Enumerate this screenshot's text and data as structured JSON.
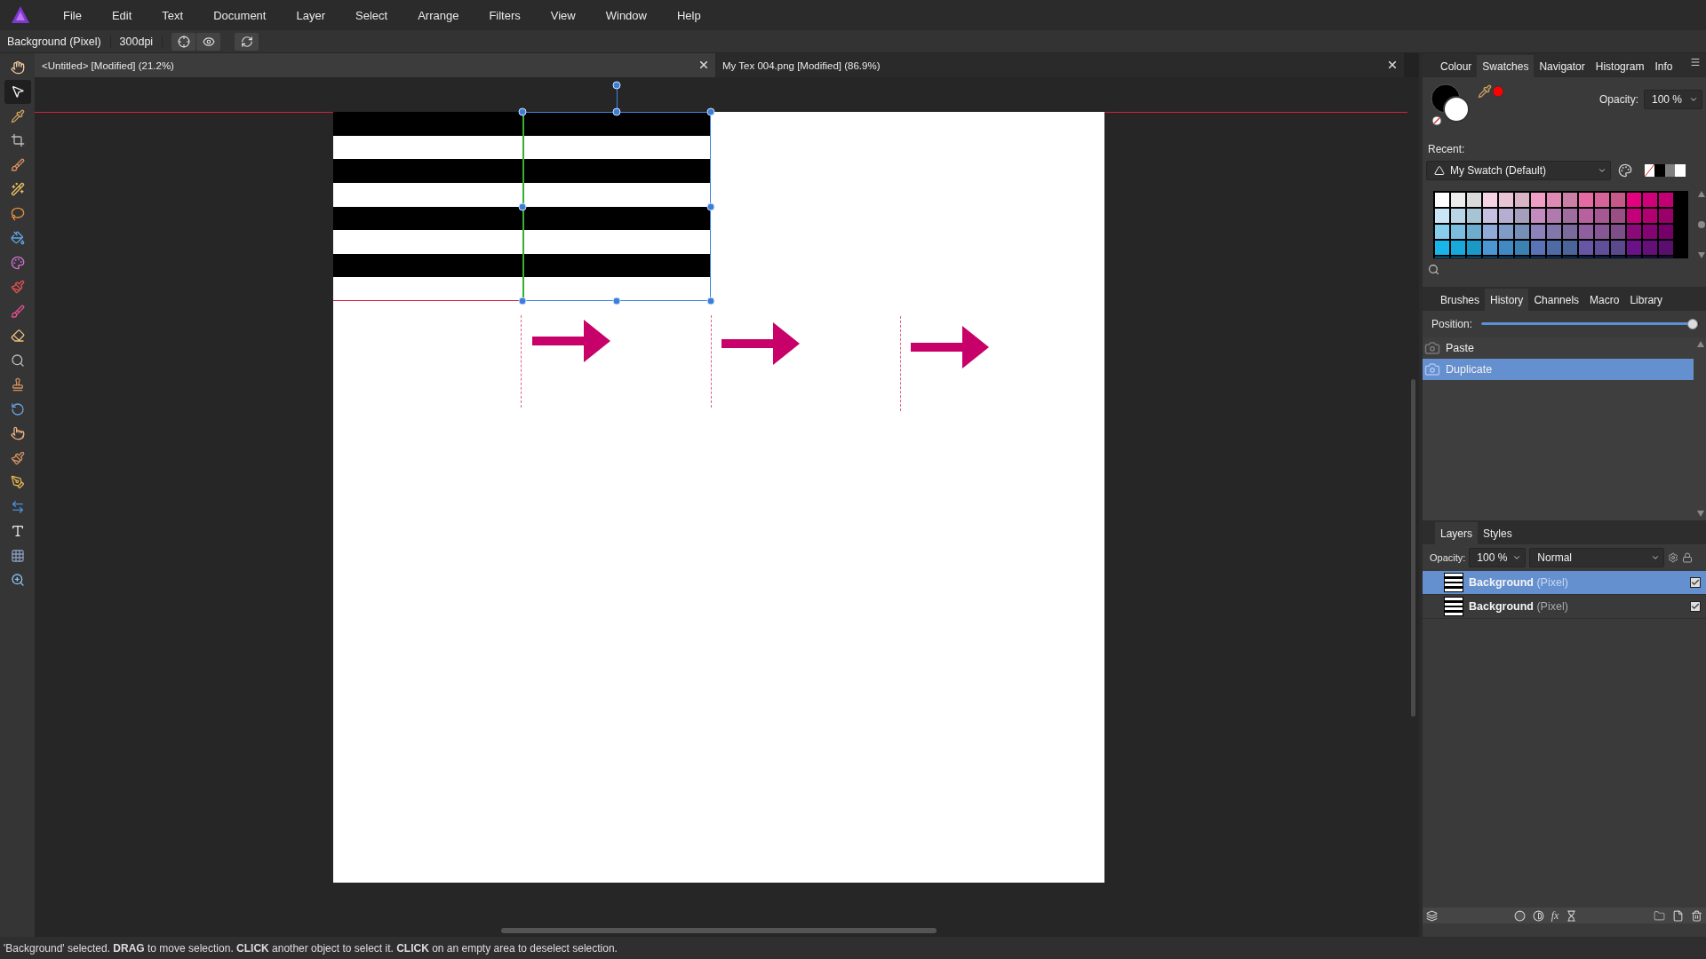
{
  "menu": [
    "File",
    "Edit",
    "Text",
    "Document",
    "Layer",
    "Select",
    "Arrange",
    "Filters",
    "View",
    "Window",
    "Help"
  ],
  "context_toolbar": {
    "layer_label": "Background (Pixel)",
    "dpi": "300dpi"
  },
  "document_tabs": [
    {
      "title": "<Untitled> [Modified] (21.2%)",
      "selected": true
    },
    {
      "title": "My Tex 004.png [Modified] (86.9%)",
      "selected": false
    }
  ],
  "tools": [
    {
      "kind": "hand",
      "selected": false
    },
    {
      "kind": "move",
      "selected": true
    },
    {
      "kind": "eyedropper",
      "selected": false
    },
    {
      "kind": "crop",
      "selected": false
    },
    {
      "kind": "selection-brush",
      "selected": false
    },
    {
      "kind": "wand",
      "selected": false
    },
    {
      "kind": "lasso",
      "selected": false
    },
    {
      "kind": "fill",
      "selected": false
    },
    {
      "kind": "colour",
      "selected": false
    },
    {
      "kind": "paint",
      "selected": false
    },
    {
      "kind": "mixer",
      "selected": false
    },
    {
      "kind": "eraser",
      "selected": false
    },
    {
      "kind": "dodge",
      "selected": false
    },
    {
      "kind": "stamp",
      "selected": false
    },
    {
      "kind": "clone",
      "selected": false
    },
    {
      "kind": "smudge",
      "selected": false
    },
    {
      "kind": "healing",
      "selected": false
    },
    {
      "kind": "pen",
      "selected": false
    },
    {
      "kind": "width",
      "selected": false
    },
    {
      "kind": "text",
      "selected": false
    },
    {
      "kind": "mesh",
      "selected": false
    },
    {
      "kind": "zoom",
      "selected": false
    }
  ],
  "colour_panel": {
    "tabs": [
      {
        "label": "Colour",
        "selected": false
      },
      {
        "label": "Swatches",
        "selected": true
      },
      {
        "label": "Navigator",
        "selected": false
      },
      {
        "label": "Histogram",
        "selected": false
      },
      {
        "label": "Info",
        "selected": false
      }
    ],
    "opacity_label": "Opacity:",
    "opacity_value": "100 %",
    "recent_label": "Recent:",
    "palette": "My Swatch (Default)"
  },
  "history_panel": {
    "tabs": [
      {
        "label": "Brushes",
        "selected": false
      },
      {
        "label": "History",
        "selected": true
      },
      {
        "label": "Channels",
        "selected": false
      },
      {
        "label": "Macro",
        "selected": false
      },
      {
        "label": "Library",
        "selected": false
      }
    ],
    "position_label": "Position:",
    "position": {
      "level": 1
    },
    "items": [
      {
        "label": "Paste",
        "selected": false
      },
      {
        "label": "Duplicate",
        "selected": true
      }
    ]
  },
  "layers_panel": {
    "tabs": [
      {
        "label": "Layers",
        "selected": true
      },
      {
        "label": "Styles",
        "selected": false
      }
    ],
    "opacity_label": "Opacity:",
    "opacity_value": "100 %",
    "blend_mode": "Normal",
    "fx_label": "fx",
    "layers": [
      {
        "name": "Background",
        "type": "(Pixel)",
        "selected": true,
        "visible": true
      },
      {
        "name": "Background",
        "type": "(Pixel)",
        "selected": false,
        "visible": true
      }
    ]
  },
  "status_bar": "'Background' selected. **DRAG** to move selection. **CLICK** another object to select it. **CLICK** on an empty area to deselect selection."
}
